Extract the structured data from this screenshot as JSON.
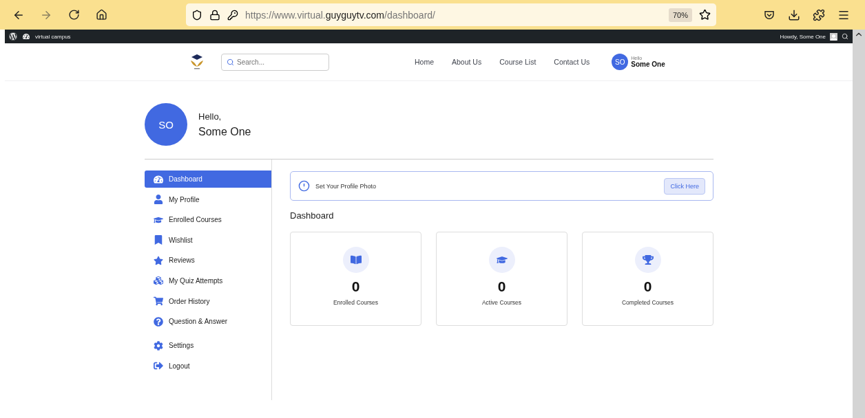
{
  "browser": {
    "url": {
      "prefix": "https://www.virtual.",
      "domain": "guyguytv.com",
      "path": "/dashboard/"
    },
    "zoom": "70%"
  },
  "admin_bar": {
    "site": "virtual campus",
    "greeting": "Howdy, Some One"
  },
  "header": {
    "search": {
      "placeholder": "Search..."
    },
    "nav": [
      "Home",
      "About Us",
      "Course List",
      "Contact Us"
    ],
    "user": {
      "initials": "SO",
      "greeting": "Hello",
      "name": "Some One"
    }
  },
  "profile": {
    "initials": "SO",
    "greeting": "Hello,",
    "name": "Some One"
  },
  "sidebar": {
    "groups": [
      [
        {
          "label": "Dashboard",
          "selected": true
        },
        {
          "label": "My Profile",
          "selected": false
        },
        {
          "label": "Enrolled Courses",
          "selected": false
        },
        {
          "label": "Wishlist",
          "selected": false
        },
        {
          "label": "Reviews",
          "selected": false
        },
        {
          "label": "My Quiz Attempts",
          "selected": false
        },
        {
          "label": "Order History",
          "selected": false
        },
        {
          "label": "Question & Answer",
          "selected": false
        }
      ],
      [
        {
          "label": "Settings",
          "selected": false
        },
        {
          "label": "Logout",
          "selected": false
        }
      ]
    ]
  },
  "notice": {
    "text": "Set Your Profile Photo",
    "button": "Click Here"
  },
  "dashboard": {
    "title": "Dashboard",
    "stats": [
      {
        "value": "0",
        "label": "Enrolled Courses"
      },
      {
        "value": "0",
        "label": "Active Courses"
      },
      {
        "value": "0",
        "label": "Completed Courses"
      }
    ]
  }
}
